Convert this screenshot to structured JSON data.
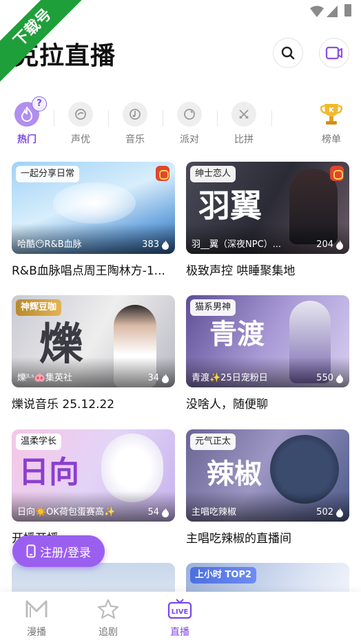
{
  "ribbon": {
    "text": "下载号"
  },
  "header": {
    "title": "克拉直播"
  },
  "icons": {
    "search": "search-icon",
    "video": "video-camera-icon",
    "question": "help-icon",
    "fire": "fire-icon",
    "flame": "flame-icon",
    "phone": "phone-icon"
  },
  "categories": [
    {
      "label": "热门",
      "icon": "fire-icon",
      "active": true
    },
    {
      "label": "声优",
      "icon": "voice-icon",
      "active": false
    },
    {
      "label": "音乐",
      "icon": "music-icon",
      "active": false
    },
    {
      "label": "派对",
      "icon": "party-icon",
      "active": false
    },
    {
      "label": "比拼",
      "icon": "battle-icon",
      "active": false
    },
    {
      "label": "榜单",
      "icon": "trophy-icon",
      "active": false
    }
  ],
  "help_badge": "?",
  "cards": [
    {
      "tag": "一起分享日常",
      "owner": "哈酷😶R&B血脉",
      "count": "383",
      "title": "R&B血脉唱点周王陶林方-1..."
    },
    {
      "tag": "绅士恋人",
      "owner": "羽__翼（深夜NPC）...",
      "count": "204",
      "title": "极致声控 哄睡聚集地",
      "art": "羽翼"
    },
    {
      "tag": "神辉豆咖",
      "owner": "爍ᴶᴸˢ🐽集英社",
      "count": "34",
      "title": "爍说音乐 25.12.22",
      "art": "爍"
    },
    {
      "tag": "猫系男神",
      "owner": "青渡✨25日宠粉日",
      "count": "550",
      "title": "没啥人，随便聊",
      "art": "青渡"
    },
    {
      "tag": "温柔学长",
      "owner": "日向☀️OK荷包蛋赛高✨",
      "count": "54",
      "title": "开播开播",
      "art": "日向"
    },
    {
      "tag": "元气正太",
      "owner": "主唱吃辣椒",
      "count": "502",
      "title": "主唱吃辣椒的直播间",
      "art": "辣椒"
    },
    {
      "tag": "",
      "owner": "",
      "count": "",
      "title": ""
    },
    {
      "tag": "上小时 TOP2",
      "owner": "",
      "count": "",
      "title": ""
    }
  ],
  "login_button": {
    "label": "注册/登录"
  },
  "bottom_nav": [
    {
      "label": "漫播",
      "active": false
    },
    {
      "label": "追剧",
      "active": false
    },
    {
      "label": "直播",
      "active": true
    }
  ],
  "colors": {
    "accent": "#7d48e8",
    "ribbon": "#1f9f3a",
    "fab": "#9b5ff0"
  }
}
